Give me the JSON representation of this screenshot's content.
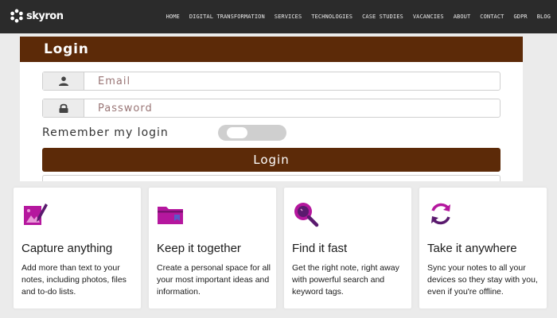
{
  "header": {
    "logo_text": "skyron",
    "nav": [
      "HOME",
      "DIGITAL TRANSFORMATION",
      "SERVICES",
      "TECHNOLOGIES",
      "CASE STUDIES",
      "VACANCIES",
      "ABOUT",
      "CONTACT",
      "GDPR",
      "BLOG"
    ]
  },
  "login": {
    "title": "Login",
    "email_placeholder": "Email",
    "email_icon": "user-icon",
    "password_placeholder": "Password",
    "password_icon": "lock-icon",
    "remember_label": "Remember my login",
    "remember_checked": false,
    "submit_label": "Login"
  },
  "features": [
    {
      "icon": "pen-image-icon",
      "title": "Capture anything",
      "text": "Add more than text to your notes, including photos, files and to-do lists."
    },
    {
      "icon": "folder-icon",
      "title": "Keep it together",
      "text": "Create a personal space for all your most important ideas and information."
    },
    {
      "icon": "magnifier-icon",
      "title": "Find it fast",
      "text": "Get the right note, right away with powerful search and keyword tags."
    },
    {
      "icon": "sync-icon",
      "title": "Take it anywhere",
      "text": "Sync your notes to all your devices so they stay with you, even if you're offline."
    }
  ],
  "colors": {
    "brand_brown": "#5c2a08",
    "accent_magenta": "#b5179e",
    "topbar": "#2b2b2b"
  }
}
